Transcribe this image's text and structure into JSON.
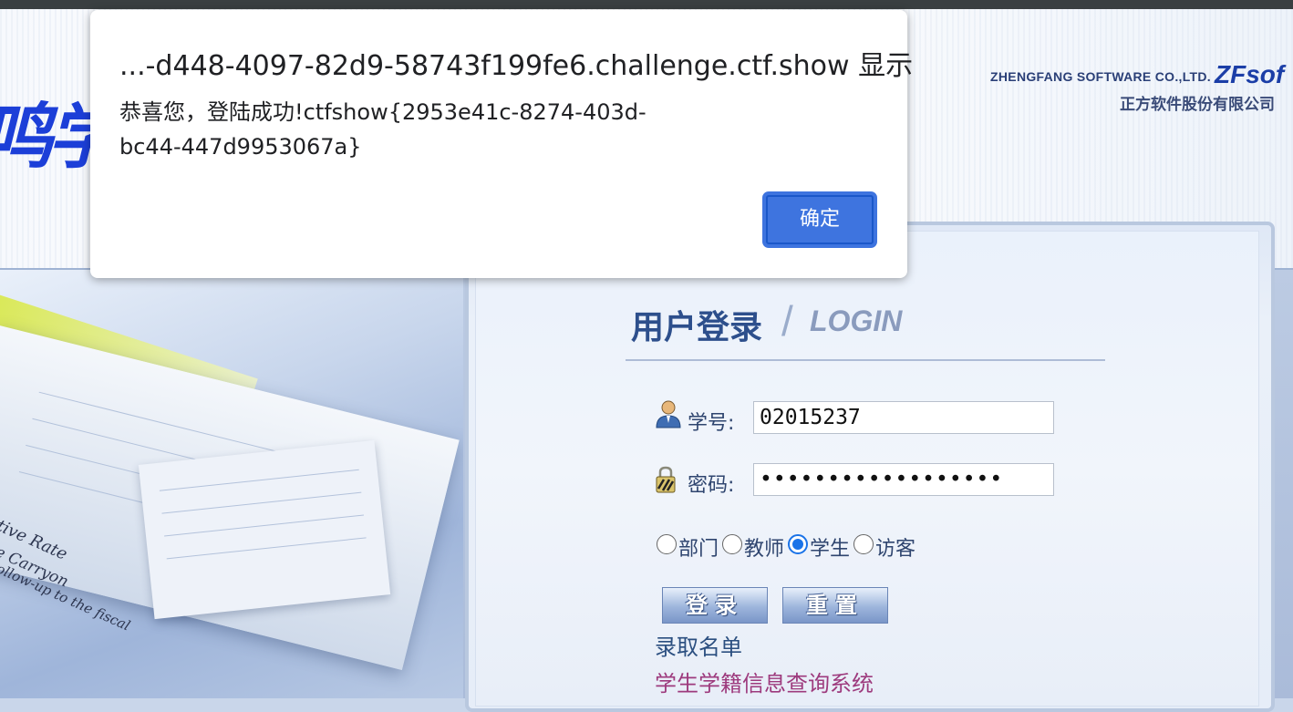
{
  "header": {
    "school_chars": [
      "鸣",
      "学"
    ],
    "company_en": "ZHENGFANG SOFTWARE CO.,LTD.",
    "company_logo": "ZFsof",
    "company_cn": "正方软件股份有限公司"
  },
  "left_pane": {
    "paper_text_1": "tive Rate",
    "paper_text_2": "e Carryon",
    "paper_text_3": "ollow-up to the fiscal"
  },
  "login": {
    "title_cn": "用户登录",
    "title_slash": "/",
    "title_en": "LOGIN",
    "username_label": "学号:",
    "username_value": "02015237",
    "password_label": "密码:",
    "password_value": "••••••••••••••••••",
    "roles": [
      {
        "label": "部门",
        "checked": false
      },
      {
        "label": "教师",
        "checked": false
      },
      {
        "label": "学生",
        "checked": true
      },
      {
        "label": "访客",
        "checked": false
      }
    ],
    "login_button": "登录",
    "reset_button": "重置",
    "link_admission": "录取名单",
    "link_status": "学生学籍信息查询系统"
  },
  "dialog": {
    "title": "...-d448-4097-82d9-58743f199fe6.challenge.ctf.show 显示",
    "message": "恭喜您，登陆成功!ctfshow{2953e41c-8274-403d-bc44-447d9953067a}",
    "ok_label": "确定",
    "accent": "#3e74df"
  },
  "colors": {
    "school_blue": "#1c3fd8",
    "label_text": "#2f456f",
    "link_purple": "#9d3a7d"
  }
}
